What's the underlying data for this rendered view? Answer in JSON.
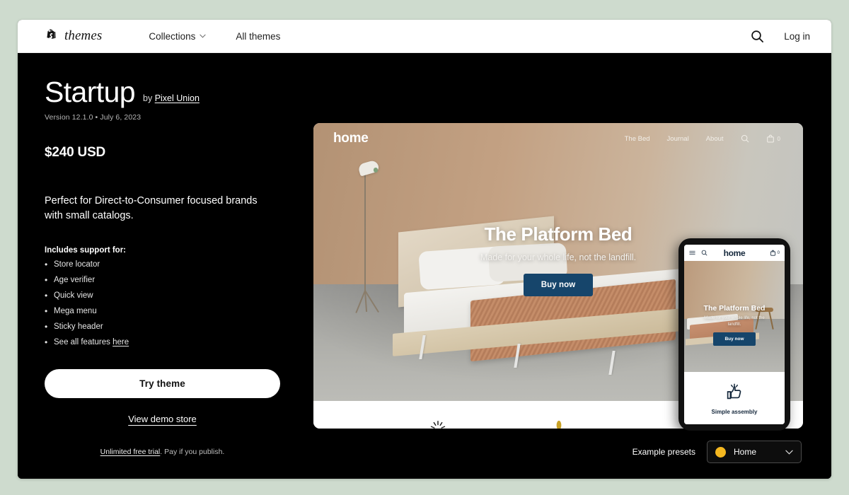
{
  "page": {
    "background_color": "#cedbce",
    "card_background": "#000000"
  },
  "topnav": {
    "brand_word": "themes",
    "brand_icon": "shopify-bag-icon",
    "links": [
      {
        "label": "Collections",
        "has_chevron": true,
        "icon": "chevron-down-icon"
      },
      {
        "label": "All themes",
        "has_chevron": false
      }
    ],
    "search_icon": "search-icon",
    "login_label": "Log in"
  },
  "theme": {
    "name": "Startup",
    "by_prefix": "by ",
    "vendor": "Pixel Union",
    "version_line": "Version 12.1.0 • July 6, 2023",
    "price": "$240 USD",
    "tagline": "Perfect for Direct-to-Consumer focused brands with small catalogs.",
    "includes_heading": "Includes support for:",
    "features": [
      {
        "text": "Store locator",
        "link": ""
      },
      {
        "text": "Age verifier",
        "link": ""
      },
      {
        "text": "Quick view",
        "link": ""
      },
      {
        "text": "Mega menu",
        "link": ""
      },
      {
        "text": "Sticky header",
        "link": ""
      },
      {
        "text": "See all features ",
        "link": "here"
      }
    ],
    "try_button": "Try theme",
    "demo_link": "View demo store",
    "trial_link": "Unlimited free trial",
    "trial_rest": ". Pay if you publish."
  },
  "preview": {
    "store_logo": "home",
    "nav_links": [
      "The Bed",
      "Journal",
      "About"
    ],
    "search_icon": "search-icon",
    "cart_icon": "cart-icon",
    "cart_count": "0",
    "hero_title": "The Platform Bed",
    "hero_subtitle": "Made for your whole life, not the landfill.",
    "hero_button": "Buy now",
    "strip_icons": [
      "sparkle-icon",
      "sprout-icon"
    ]
  },
  "phone_preview": {
    "menu_icon": "hamburger-menu-icon",
    "search_icon": "search-icon",
    "store_logo": "home",
    "cart_icon": "cart-icon",
    "cart_count": "0",
    "hero_title": "The Platform Bed",
    "hero_subtitle": "Made for your whole life, not the landfill.",
    "hero_button": "Buy now",
    "feature_icon": "thumbs-up-icon",
    "feature_title": "Simple assembly"
  },
  "presets": {
    "label": "Example presets",
    "selected": "Home",
    "swatch_color": "#f5b820",
    "chevron_icon": "chevron-down-icon"
  }
}
